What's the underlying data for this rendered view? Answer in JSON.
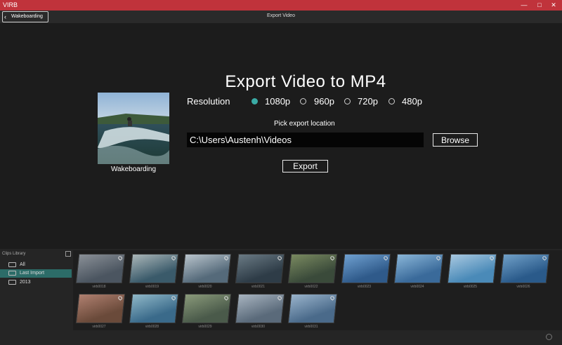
{
  "window": {
    "title": "VIRB"
  },
  "toolbar": {
    "back_label": "Wakeboarding",
    "title": "Export Video"
  },
  "export": {
    "heading": "Export Video to MP4",
    "thumbnail_caption": "Wakeboarding",
    "resolution_label": "Resolution",
    "resolutions": [
      {
        "label": "1080p",
        "selected": true
      },
      {
        "label": "960p",
        "selected": false
      },
      {
        "label": "720p",
        "selected": false
      },
      {
        "label": "480p",
        "selected": false
      }
    ],
    "pick_location_label": "Pick export location",
    "path_value": "C:\\Users\\Austenh\\Videos",
    "browse_label": "Browse",
    "export_label": "Export",
    "accent_color": "#3aaba5"
  },
  "library": {
    "title": "Clips Library",
    "items": [
      {
        "label": "All",
        "active": false
      },
      {
        "label": "Last Import",
        "active": true
      },
      {
        "label": "2013",
        "active": false
      }
    ]
  },
  "clips": [
    {
      "name": "virb0018"
    },
    {
      "name": "virb0019"
    },
    {
      "name": "virb0020"
    },
    {
      "name": "virb0021"
    },
    {
      "name": "virb0022"
    },
    {
      "name": "virb0023"
    },
    {
      "name": "virb0024"
    },
    {
      "name": "virb0025"
    },
    {
      "name": "virb0026"
    },
    {
      "name": "virb0027"
    },
    {
      "name": "virb0028"
    },
    {
      "name": "virb0029"
    },
    {
      "name": "virb0030"
    },
    {
      "name": "virb0031"
    }
  ]
}
